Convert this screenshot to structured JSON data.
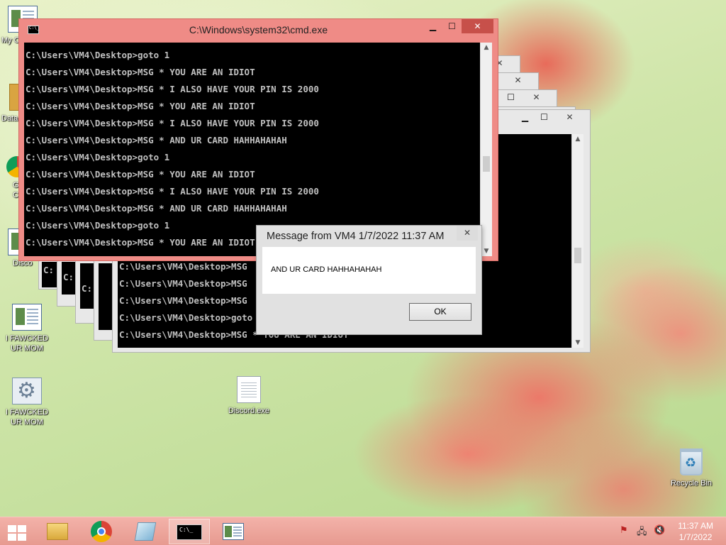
{
  "desktop": {
    "icons": [
      {
        "name": "my-computer-icon",
        "label": "My C"
      },
      {
        "name": "data-icon",
        "label": "Data"
      },
      {
        "name": "chrome-desktop-icon",
        "label": "G\nC"
      },
      {
        "name": "discord-shortcut-icon",
        "label": "Disco"
      },
      {
        "name": "app-window-icon",
        "label": "I FAWCKED\nUR MOM"
      },
      {
        "name": "app-settings-icon",
        "label": "I FAWCKED\nUR MOM"
      },
      {
        "name": "discord-exe-icon",
        "label": "Discord.exe"
      },
      {
        "name": "recycle-bin-icon",
        "label": "Recycle Bin"
      }
    ]
  },
  "console": {
    "title": "C:\\Windows\\system32\\cmd.exe",
    "lines": [
      "C:\\Users\\VM4\\Desktop>goto 1",
      "C:\\Users\\VM4\\Desktop>MSG * YOU ARE AN IDIOT",
      "C:\\Users\\VM4\\Desktop>MSG * I ALSO HAVE YOUR PIN IS 2000",
      "C:\\Users\\VM4\\Desktop>MSG * YOU ARE AN IDIOT",
      "C:\\Users\\VM4\\Desktop>MSG * I ALSO HAVE YOUR PIN IS 2000",
      "C:\\Users\\VM4\\Desktop>MSG * AND UR CARD HAHHAHAHAH",
      "C:\\Users\\VM4\\Desktop>goto 1",
      "C:\\Users\\VM4\\Desktop>MSG * YOU ARE AN IDIOT",
      "C:\\Users\\VM4\\Desktop>MSG * I ALSO HAVE YOUR PIN IS 2000",
      "C:\\Users\\VM4\\Desktop>MSG * AND UR CARD HAHHAHAHAH",
      "C:\\Users\\VM4\\Desktop>goto 1",
      "C:\\Users\\VM4\\Desktop>MSG * YOU ARE AN IDIOT"
    ],
    "back_lines": [
      "C:\\Users\\VM4\\Desktop>MSG",
      "C:\\Users\\VM4\\Desktop>MSG",
      "C:\\Users\\VM4\\Desktop>MSG",
      "C:\\Users\\VM4\\Desktop>goto",
      "C:\\Users\\VM4\\Desktop>MSG * YOU ARE AN IDIOT"
    ],
    "stack_fragments": [
      "C:",
      "C:",
      "C:"
    ]
  },
  "message_box": {
    "title": "Message from VM4 1/7/2022 11:37 AM",
    "text": "AND UR CARD HAHHAHAHAH",
    "ok_label": "OK"
  },
  "window_controls": {
    "minimize": "▁",
    "maximize": "☐",
    "close": "✕"
  },
  "taskbar": {
    "apps": [
      {
        "name": "file-explorer-icon"
      },
      {
        "name": "chrome-icon"
      },
      {
        "name": "notepad-icon"
      },
      {
        "name": "cmd-icon",
        "active": true
      },
      {
        "name": "app-window-icon"
      }
    ],
    "time": "11:37 AM",
    "date": "1/7/2022"
  },
  "colors": {
    "active_frame": "#ef8b86",
    "console_bg": "#000000",
    "console_text": "#c0c0c0"
  }
}
